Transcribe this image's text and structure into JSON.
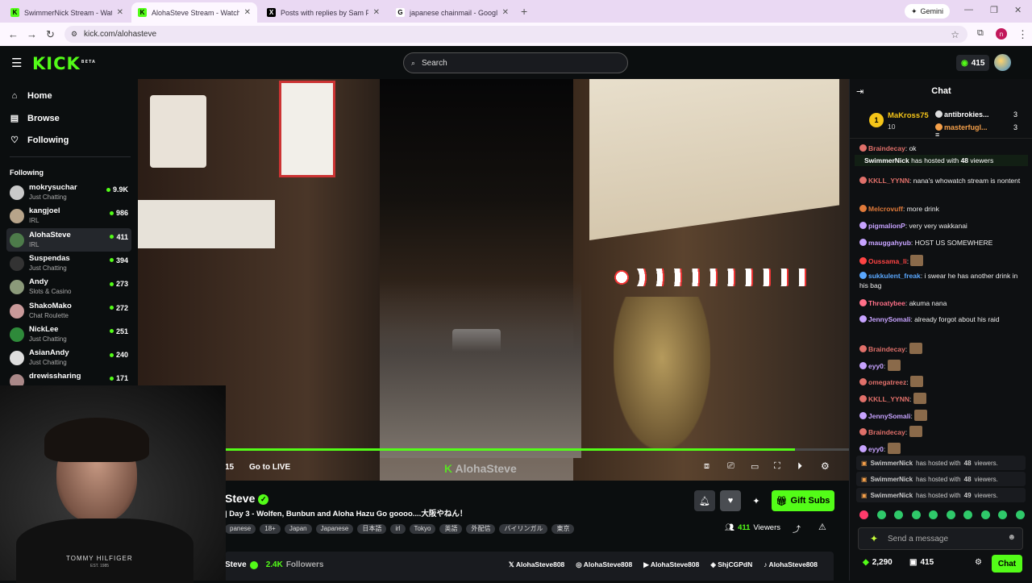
{
  "browser": {
    "tabs": [
      {
        "title": "SwimmerNick Stream - Watch Li",
        "favicon": "K",
        "active": false
      },
      {
        "title": "AlohaSteve Stream - Watch Live",
        "favicon": "K",
        "active": true
      },
      {
        "title": "Posts with replies by Sam Pepp",
        "favicon": "X",
        "active": false
      },
      {
        "title": "japanese chainmail - Google Se",
        "favicon": "G",
        "active": false
      }
    ],
    "gemini_label": "Gemini",
    "url": "kick.com/alohasteve",
    "profile_initial": "n"
  },
  "header": {
    "logo": "KICK",
    "logo_badge": "BETA",
    "search_placeholder": "Search",
    "points": "415"
  },
  "sidebar": {
    "nav": [
      "Home",
      "Browse",
      "Following"
    ],
    "following_header": "Following",
    "channels": [
      {
        "name": "mokrysuchar",
        "category": "Just Chatting",
        "viewers": "9.9K",
        "color": "#c9c9c9",
        "selected": false
      },
      {
        "name": "kangjoel",
        "category": "IRL",
        "viewers": "986",
        "color": "#b7a48a",
        "selected": false
      },
      {
        "name": "AlohaSteve",
        "category": "IRL",
        "viewers": "411",
        "color": "#4d7b4a",
        "selected": true
      },
      {
        "name": "Suspendas",
        "category": "Just Chatting",
        "viewers": "394",
        "color": "#333",
        "selected": false
      },
      {
        "name": "Andy",
        "category": "Slots & Casino",
        "viewers": "273",
        "color": "#8b9a7a",
        "selected": false
      },
      {
        "name": "ShakoMako",
        "category": "Chat Roulette",
        "viewers": "272",
        "color": "#c99a9a",
        "selected": false
      },
      {
        "name": "NickLee",
        "category": "Just Chatting",
        "viewers": "251",
        "color": "#2e8a3a",
        "selected": false
      },
      {
        "name": "AsianAndy",
        "category": "Just Chatting",
        "viewers": "240",
        "color": "#ddd",
        "selected": false
      },
      {
        "name": "drewissharing",
        "category": "",
        "viewers": "171",
        "color": "#a88",
        "selected": false
      }
    ]
  },
  "video": {
    "time": "15",
    "go_live": "Go to LIVE",
    "watermark": "AlohaSteve",
    "progress": 0.914
  },
  "stream": {
    "name": "Steve",
    "title": "| Day 3 - Wolfen, Bunbun and Aloha Hazu Go goooo....大阪やねん！",
    "tags": [
      "panese",
      "18+",
      "Japan",
      "Japanese",
      "日本語",
      "irl",
      "Tokyo",
      "英語",
      "外配信",
      "バイリンガル",
      "東京"
    ],
    "viewers": "411",
    "viewers_label": "Viewers",
    "gift_subs": "Gift Subs",
    "footer_name": "Steve",
    "followers": "2.4K",
    "followers_label": "Followers",
    "socials": [
      {
        "icon": "x-icon",
        "handle": "AlohaSteve808"
      },
      {
        "icon": "instagram-icon",
        "handle": "AlohaSteve808"
      },
      {
        "icon": "youtube-icon",
        "handle": "AlohaSteve808"
      },
      {
        "icon": "discord-icon",
        "handle": "ShjCGPdN"
      },
      {
        "icon": "tiktok-icon",
        "handle": "AlohaSteve808"
      }
    ]
  },
  "webcam": {
    "shirt_text": "TOMMY HILFIGER",
    "shirt_sub": "EST. 1985"
  },
  "chat": {
    "title": "Chat",
    "top_gifters": [
      {
        "rank": "1",
        "name": "MaKross75",
        "count": "10"
      },
      {
        "name": "antibrokies...",
        "count": "3"
      },
      {
        "name": "masterfugl...",
        "count": "3"
      }
    ],
    "host_top": {
      "user": "SwimmerNick",
      "text": "has hosted with",
      "count": "48",
      "suffix": "viewers"
    },
    "messages": [
      {
        "user": "Braindecay",
        "text": "ok",
        "color": "#e0706a"
      },
      {
        "user": "KKLL_YYNN",
        "text": "nana's whowatch stream is nontent",
        "color": "#e0706a"
      },
      {
        "user": "Melcrovuff",
        "text": "more drink",
        "color": "#e07a3a"
      },
      {
        "user": "pigmalionP",
        "text": "very very wakkanai",
        "color": "#c7a3ff"
      },
      {
        "user": "mauggahyub",
        "text": "HOST US SOMEWHERE",
        "color": "#c7a3ff"
      },
      {
        "user": "Oussama_li",
        "text": "",
        "color": "#ff4444"
      },
      {
        "user": "sukkulent_freak",
        "text": "i swear he has another drink in his bag",
        "color": "#5aa8ff"
      },
      {
        "user": "Throatybee",
        "text": "akuma nana",
        "color": "#ff7088"
      },
      {
        "user": "JennySomali",
        "text": "already forgot about his raid",
        "color": "#c7a3ff"
      },
      {
        "user": "Braindecay",
        "text": "",
        "color": "#e0706a"
      },
      {
        "user": "eyy0",
        "text": "",
        "color": "#c7a3ff"
      },
      {
        "user": "omegatreez",
        "text": "",
        "color": "#e0706a"
      },
      {
        "user": "KKLL_YYNN",
        "text": "",
        "color": "#e0706a"
      },
      {
        "user": "JennySomali",
        "text": "",
        "color": "#c7a3ff"
      },
      {
        "user": "Braindecay",
        "text": "",
        "color": "#e0706a"
      },
      {
        "user": "eyy0",
        "text": "",
        "color": "#c7a3ff"
      }
    ],
    "hosts": [
      {
        "user": "SwimmerNick",
        "text": "has hosted with",
        "count": "48",
        "suffix": "viewers."
      },
      {
        "user": "SwimmerNick",
        "text": "has hosted with",
        "count": "48",
        "suffix": "viewers."
      },
      {
        "user": "SwimmerNick",
        "text": "has hosted with",
        "count": "49",
        "suffix": "viewers."
      }
    ],
    "send_placeholder": "Send a message",
    "balance": "2,290",
    "points": "415",
    "chat_button": "Chat"
  },
  "colors": {
    "accent": "#53fc18",
    "bg": "#0b0e0f"
  }
}
